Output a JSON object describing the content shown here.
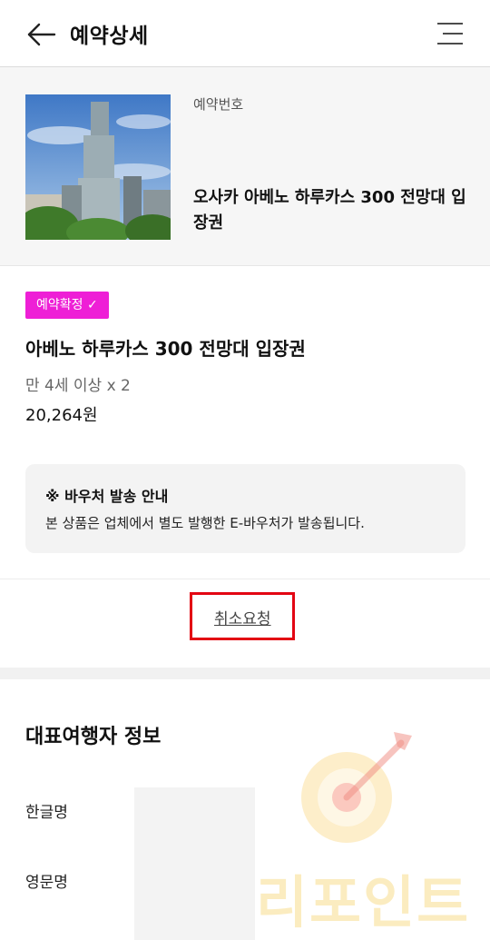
{
  "header": {
    "title": "예약상세",
    "back_icon": "arrow-left-icon",
    "menu_icon": "hamburger-menu-icon"
  },
  "summary": {
    "reservation_label": "예약번호",
    "title": "오사카 아베노 하루카스 300 전망대 입장권"
  },
  "product": {
    "status_badge": "예약확정 ✓",
    "status_color": "#ee1fd6",
    "name": "아베노 하루카스 300 전망대 입장권",
    "option": "만 4세 이상 x 2",
    "price": "20,264원"
  },
  "notice": {
    "title": "※ 바우처 발송 안내",
    "body": "본 상품은 업체에서 별도 발행한 E-바우처가 발송됩니다."
  },
  "actions": {
    "cancel_label": "취소요청",
    "highlight_color": "#e30613"
  },
  "traveler": {
    "section_title": "대표여행자 정보",
    "korean_name_label": "한글명",
    "english_name_label": "영문명"
  },
  "watermark": {
    "text": "리포인트",
    "icon": "target-arrow-icon"
  }
}
